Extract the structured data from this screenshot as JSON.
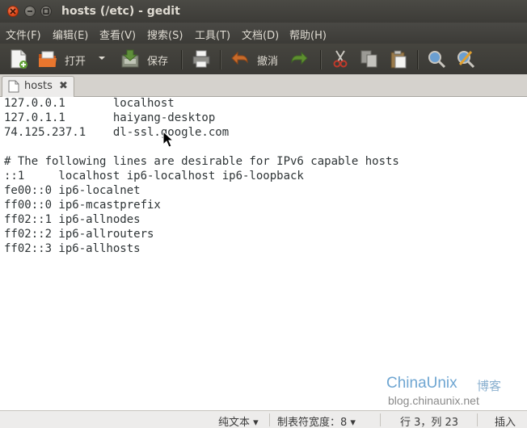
{
  "window": {
    "title": "hosts (/etc) - gedit"
  },
  "menu": [
    {
      "label": "文件(F)"
    },
    {
      "label": "编辑(E)"
    },
    {
      "label": "查看(V)"
    },
    {
      "label": "搜索(S)"
    },
    {
      "label": "工具(T)"
    },
    {
      "label": "文档(D)"
    },
    {
      "label": "帮助(H)"
    }
  ],
  "toolbar": {
    "open_label": "打开",
    "save_label": "保存",
    "undo_label": "撤消"
  },
  "tab": {
    "label": "hosts"
  },
  "editor": {
    "lines": [
      "127.0.0.1       localhost",
      "127.0.1.1       haiyang-desktop",
      "74.125.237.1    dl-ssl.google.com",
      "",
      "# The following lines are desirable for IPv6 capable hosts",
      "::1     localhost ip6-localhost ip6-loopback",
      "fe00::0 ip6-localnet",
      "ff00::0 ip6-mcastprefix",
      "ff02::1 ip6-allnodes",
      "ff02::2 ip6-allrouters",
      "ff02::3 ip6-allhosts"
    ]
  },
  "watermark": {
    "brand_main": "ChinaUnix",
    "brand_suffix": "博客",
    "url": "blog.chinaunix.net"
  },
  "status": {
    "language": "纯文本",
    "tab_width": "制表符宽度：8",
    "position": "行 3，列 23",
    "mode": "插入"
  },
  "colors": {
    "titlebar": "#3c3b37",
    "close_button": "#e0481b",
    "editor_bg": "#ffffff"
  }
}
